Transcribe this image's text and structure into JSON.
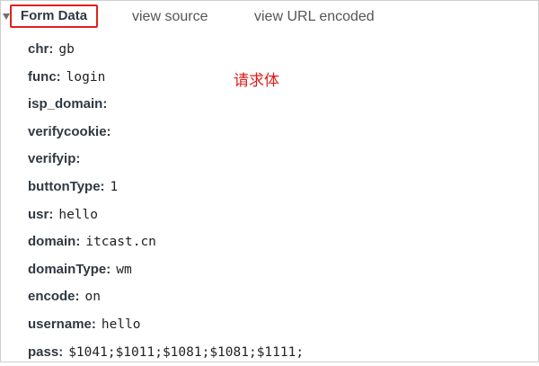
{
  "tabs": {
    "form_data": "Form Data",
    "view_source": "view source",
    "view_url_encoded": "view URL encoded"
  },
  "annotation": "请求体",
  "colors": {
    "highlight_box": "#e0201c",
    "annotation": "#e11b1b",
    "key_text": "#303942"
  },
  "fields": [
    {
      "key": "chr:",
      "value": "gb"
    },
    {
      "key": "func:",
      "value": "login"
    },
    {
      "key": "isp_domain:",
      "value": ""
    },
    {
      "key": "verifycookie:",
      "value": ""
    },
    {
      "key": "verifyip:",
      "value": ""
    },
    {
      "key": "buttonType:",
      "value": "1"
    },
    {
      "key": "usr:",
      "value": "hello"
    },
    {
      "key": "domain:",
      "value": "itcast.cn"
    },
    {
      "key": "domainType:",
      "value": "wm"
    },
    {
      "key": "encode:",
      "value": "on"
    },
    {
      "key": "username:",
      "value": "hello"
    },
    {
      "key": "pass:",
      "value": "$1041;$1011;$1081;$1081;$1111;"
    }
  ]
}
